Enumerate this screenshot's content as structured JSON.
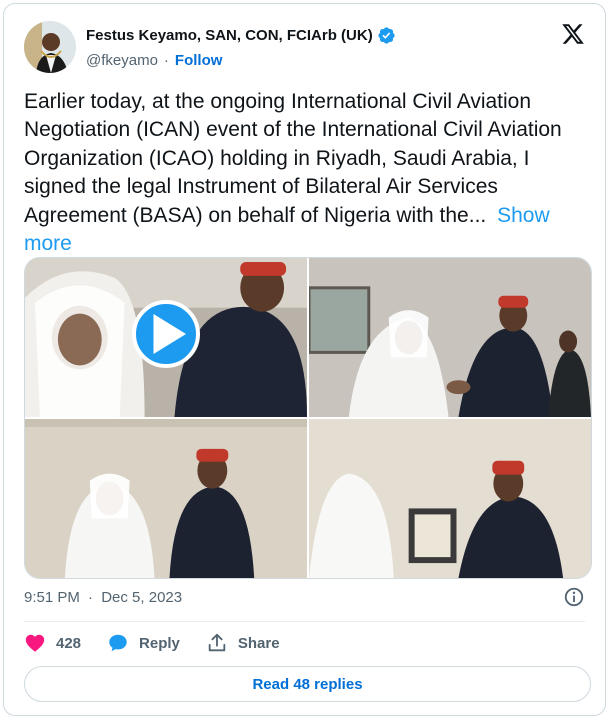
{
  "author": {
    "name": "Festus Keyamo, SAN, CON, FCIArb (UK)",
    "handle": "@fkeyamo",
    "follow_label": "Follow",
    "verified_icon": "verified-badge-icon"
  },
  "tweet": {
    "text": "Earlier today, at the ongoing International Civil Aviation Negotiation (ICAN) event of the International Civil Aviation Organization (ICAO) holding in Riyadh, Saudi Arabia, I signed the legal Instrument of Bilateral Air Services Agreement (BASA) on behalf of Nigeria with the...",
    "show_more": "Show more"
  },
  "media": {
    "count": 4,
    "has_video": true,
    "play_icon": "play-icon"
  },
  "meta": {
    "time": "9:51 PM",
    "separator": "·",
    "date": "Dec 5, 2023"
  },
  "actions": {
    "like_count": "428",
    "reply_label": "Reply",
    "share_label": "Share"
  },
  "read_replies": "Read 48 replies",
  "colors": {
    "accent": "#1d9bf0",
    "link": "#006fd6",
    "like": "#f91880",
    "text": "#0f1419",
    "muted": "#536471",
    "border": "#cfd9de"
  }
}
